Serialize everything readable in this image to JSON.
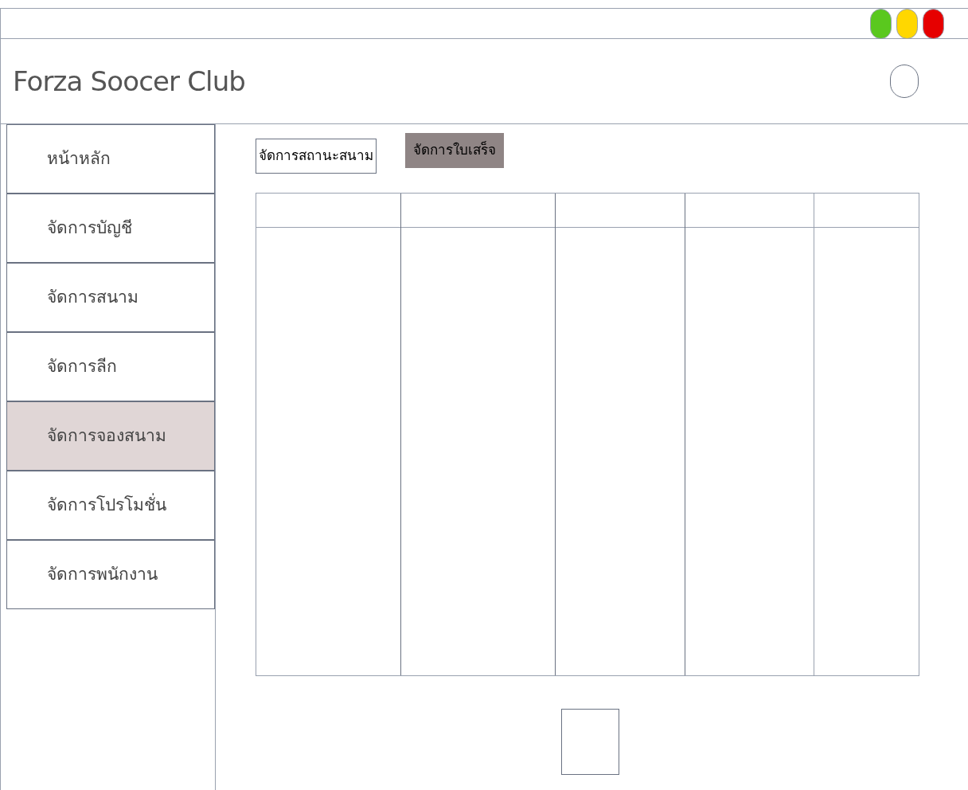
{
  "window_controls": [
    {
      "color": "#5ac81e"
    },
    {
      "color": "#ffd700"
    },
    {
      "color": "#e60000"
    }
  ],
  "header": {
    "title": "Forza Soocer Club"
  },
  "sidebar": {
    "items": [
      {
        "label": "หน้าหลัก",
        "selected": false
      },
      {
        "label": "จัดการบัญชี",
        "selected": false
      },
      {
        "label": "จัดการสนาม",
        "selected": false
      },
      {
        "label": "จัดการลีก",
        "selected": false
      },
      {
        "label": "จัดการจองสนาม",
        "selected": true
      },
      {
        "label": "จัดการโปรโมชั่น",
        "selected": false
      },
      {
        "label": "จัดการพนักงาน",
        "selected": false
      }
    ]
  },
  "tabs": [
    {
      "label": "จัดการสถานะสนาม",
      "selected": false
    },
    {
      "label": "จัดการใบเสร็จ",
      "selected": true
    }
  ]
}
